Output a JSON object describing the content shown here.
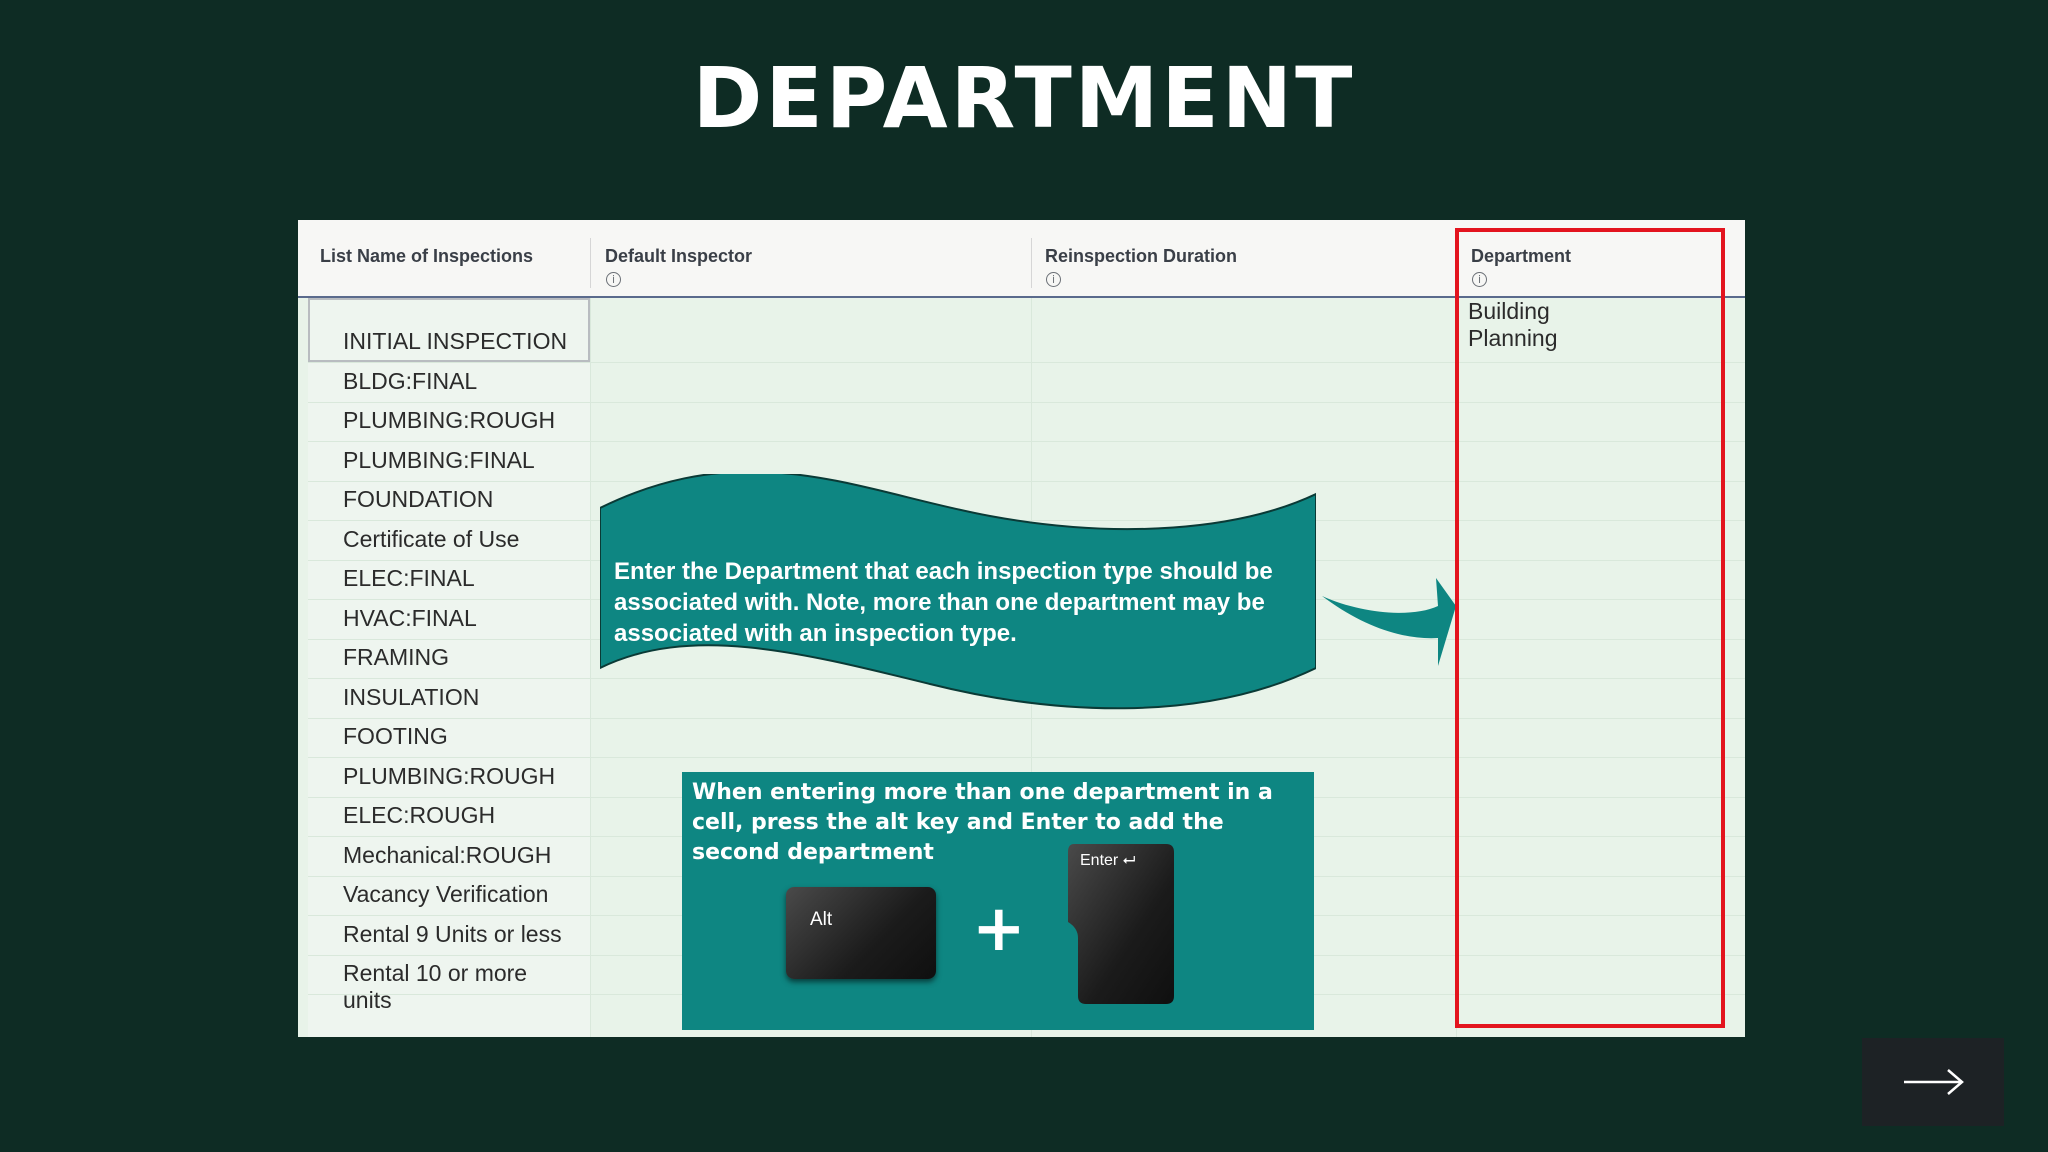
{
  "slide": {
    "title": "DEPARTMENT"
  },
  "table": {
    "columns": [
      {
        "label": "List Name of Inspections"
      },
      {
        "label": "Default Inspector"
      },
      {
        "label": "Reinspection Duration"
      },
      {
        "label": "Department"
      }
    ],
    "rows": [
      "INITIAL INSPECTION",
      "BLDG:FINAL",
      "PLUMBING:ROUGH",
      "PLUMBING:FINAL",
      "FOUNDATION",
      "Certificate of Use",
      "ELEC:FINAL",
      "HVAC:FINAL",
      "FRAMING",
      "INSULATION",
      "FOOTING",
      "PLUMBING:ROUGH",
      "ELEC:ROUGH",
      "Mechanical:ROUGH",
      "Vacancy Verification",
      "Rental 9 Units or less",
      "Rental 10 or more\nunits"
    ],
    "first_row_department": "Building\nPlanning"
  },
  "callout": {
    "text": "Enter the Department that each inspection type should be associated with.  Note, more than one department may be associated with an inspection type."
  },
  "tip": {
    "text": "When entering more than one department in a cell, press the alt key and Enter to add the second department",
    "key1": "Alt",
    "key2": "Enter ⮠",
    "plus": "+"
  },
  "colors": {
    "background": "#0e2c24",
    "accent_teal": "#0e8682",
    "highlight_red": "#e3141e"
  },
  "icons": {
    "info": "info-circle-icon",
    "next": "arrow-right-icon",
    "pointer": "curved-arrow-icon"
  }
}
